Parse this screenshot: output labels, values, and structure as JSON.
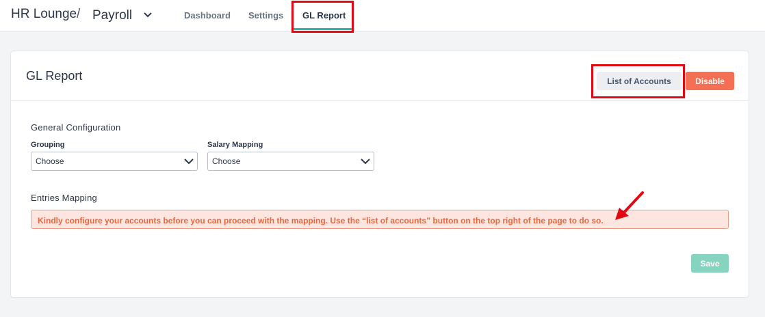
{
  "header": {
    "brand": "HR Lounge",
    "separator": "/",
    "module": "Payroll",
    "module_icon": "chevron-down-icon",
    "tabs": [
      {
        "label": "Dashboard"
      },
      {
        "label": "Settings"
      },
      {
        "label": "GL Report",
        "active": true
      }
    ]
  },
  "card": {
    "title": "GL Report",
    "list_accounts_label": "List of Accounts",
    "disable_label": "Disable",
    "general_title": "General Configuration",
    "grouping": {
      "label": "Grouping",
      "value": "Choose"
    },
    "salary_mapping": {
      "label": "Salary Mapping",
      "value": "Choose"
    },
    "entries_title": "Entries Mapping",
    "alert_text": "Kindly configure your accounts before you can proceed with the mapping. Use the “list of accounts” button on the top right of the page to do so.",
    "save_label": "Save"
  },
  "colors": {
    "accent_teal": "#38b2ac",
    "disable_button": "#f56f55",
    "save_button": "#86d3bf",
    "alert_bg": "#fde6df",
    "alert_text": "#e9673f",
    "annotation_red": "#e30613"
  }
}
